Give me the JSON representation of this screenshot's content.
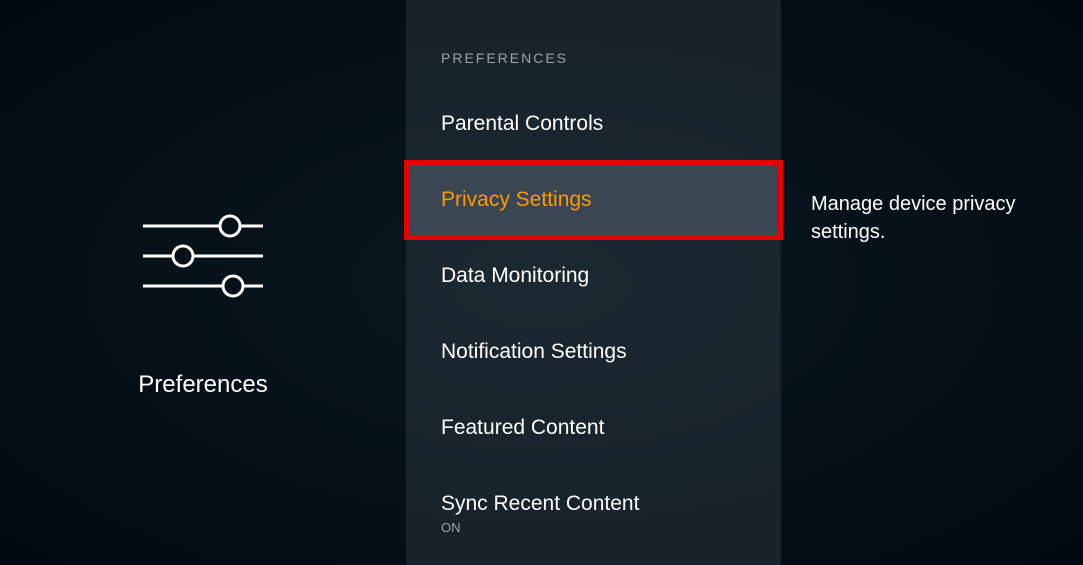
{
  "left": {
    "title": "Preferences"
  },
  "middle": {
    "header": "PREFERENCES",
    "items": [
      {
        "label": "Parental Controls"
      },
      {
        "label": "Privacy Settings"
      },
      {
        "label": "Data Monitoring"
      },
      {
        "label": "Notification Settings"
      },
      {
        "label": "Featured Content"
      },
      {
        "label": "Sync Recent Content",
        "sub": "ON"
      }
    ]
  },
  "right": {
    "description": "Manage device privacy settings."
  }
}
